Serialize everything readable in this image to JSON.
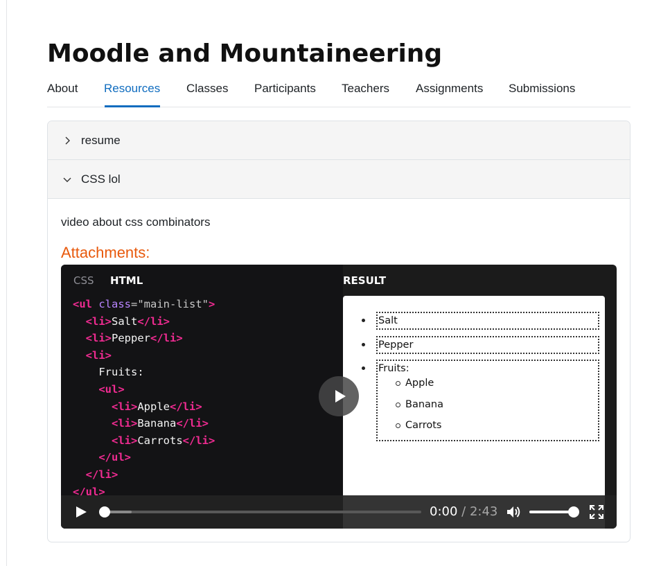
{
  "course": {
    "title": "Moodle and Mountaineering"
  },
  "tabs": [
    {
      "label": "About"
    },
    {
      "label": "Resources",
      "active": true
    },
    {
      "label": "Classes"
    },
    {
      "label": "Participants"
    },
    {
      "label": "Teachers"
    },
    {
      "label": "Assignments"
    },
    {
      "label": "Submissions"
    }
  ],
  "sections": [
    {
      "title": "resume",
      "expanded": false,
      "icon": "chevron-right-icon"
    },
    {
      "title": "CSS lol",
      "expanded": true,
      "icon": "chevron-down-icon",
      "description": "video about css combinators",
      "attachments_label": "Attachments:"
    }
  ],
  "video": {
    "code_tabs": [
      "CSS",
      "HTML"
    ],
    "active_code_tab": "HTML",
    "result_label": "RESULT",
    "code": {
      "l1": {
        "open": "<ul ",
        "attr": "class",
        "eq": "=",
        "val": "\"main-list\"",
        "close": ">"
      },
      "l2": {
        "indent": "  ",
        "open": "<li>",
        "text": "Salt",
        "close": "</li>"
      },
      "l3": {
        "indent": "  ",
        "open": "<li>",
        "text": "Pepper",
        "close": "</li>"
      },
      "l4": {
        "indent": "  ",
        "open": "<li>"
      },
      "l5": {
        "indent": "    ",
        "text": "Fruits:"
      },
      "l6": {
        "indent": "    ",
        "open": "<ul>"
      },
      "l7": {
        "indent": "      ",
        "open": "<li>",
        "text": "Apple",
        "close": "</li>"
      },
      "l8": {
        "indent": "      ",
        "open": "<li>",
        "text": "Banana",
        "close": "</li>"
      },
      "l9": {
        "indent": "      ",
        "open": "<li>",
        "text": "Carrots",
        "close": "</li>"
      },
      "l10": {
        "indent": "    ",
        "close": "</ul>"
      },
      "l11": {
        "indent": "  ",
        "close": "</li>"
      },
      "l12": {
        "close": "</ul>"
      }
    },
    "result": {
      "items": [
        "Salt",
        "Pepper",
        "Fruits:"
      ],
      "sub_items": [
        "Apple",
        "Banana",
        "Carrots"
      ]
    },
    "controls": {
      "current_time": "0:00",
      "separator": " / ",
      "duration": "2:43",
      "progress": 0,
      "buffered": 0.085,
      "volume": 1
    },
    "icons": {
      "big_play": "play-icon",
      "play": "play-icon",
      "volume": "volume-icon",
      "fullscreen": "fullscreen-icon"
    }
  },
  "colors": {
    "accent": "#0f6cbf",
    "attachments": "#e8590c",
    "code_tag": "#ef2b91",
    "code_attr": "#b884ff"
  }
}
